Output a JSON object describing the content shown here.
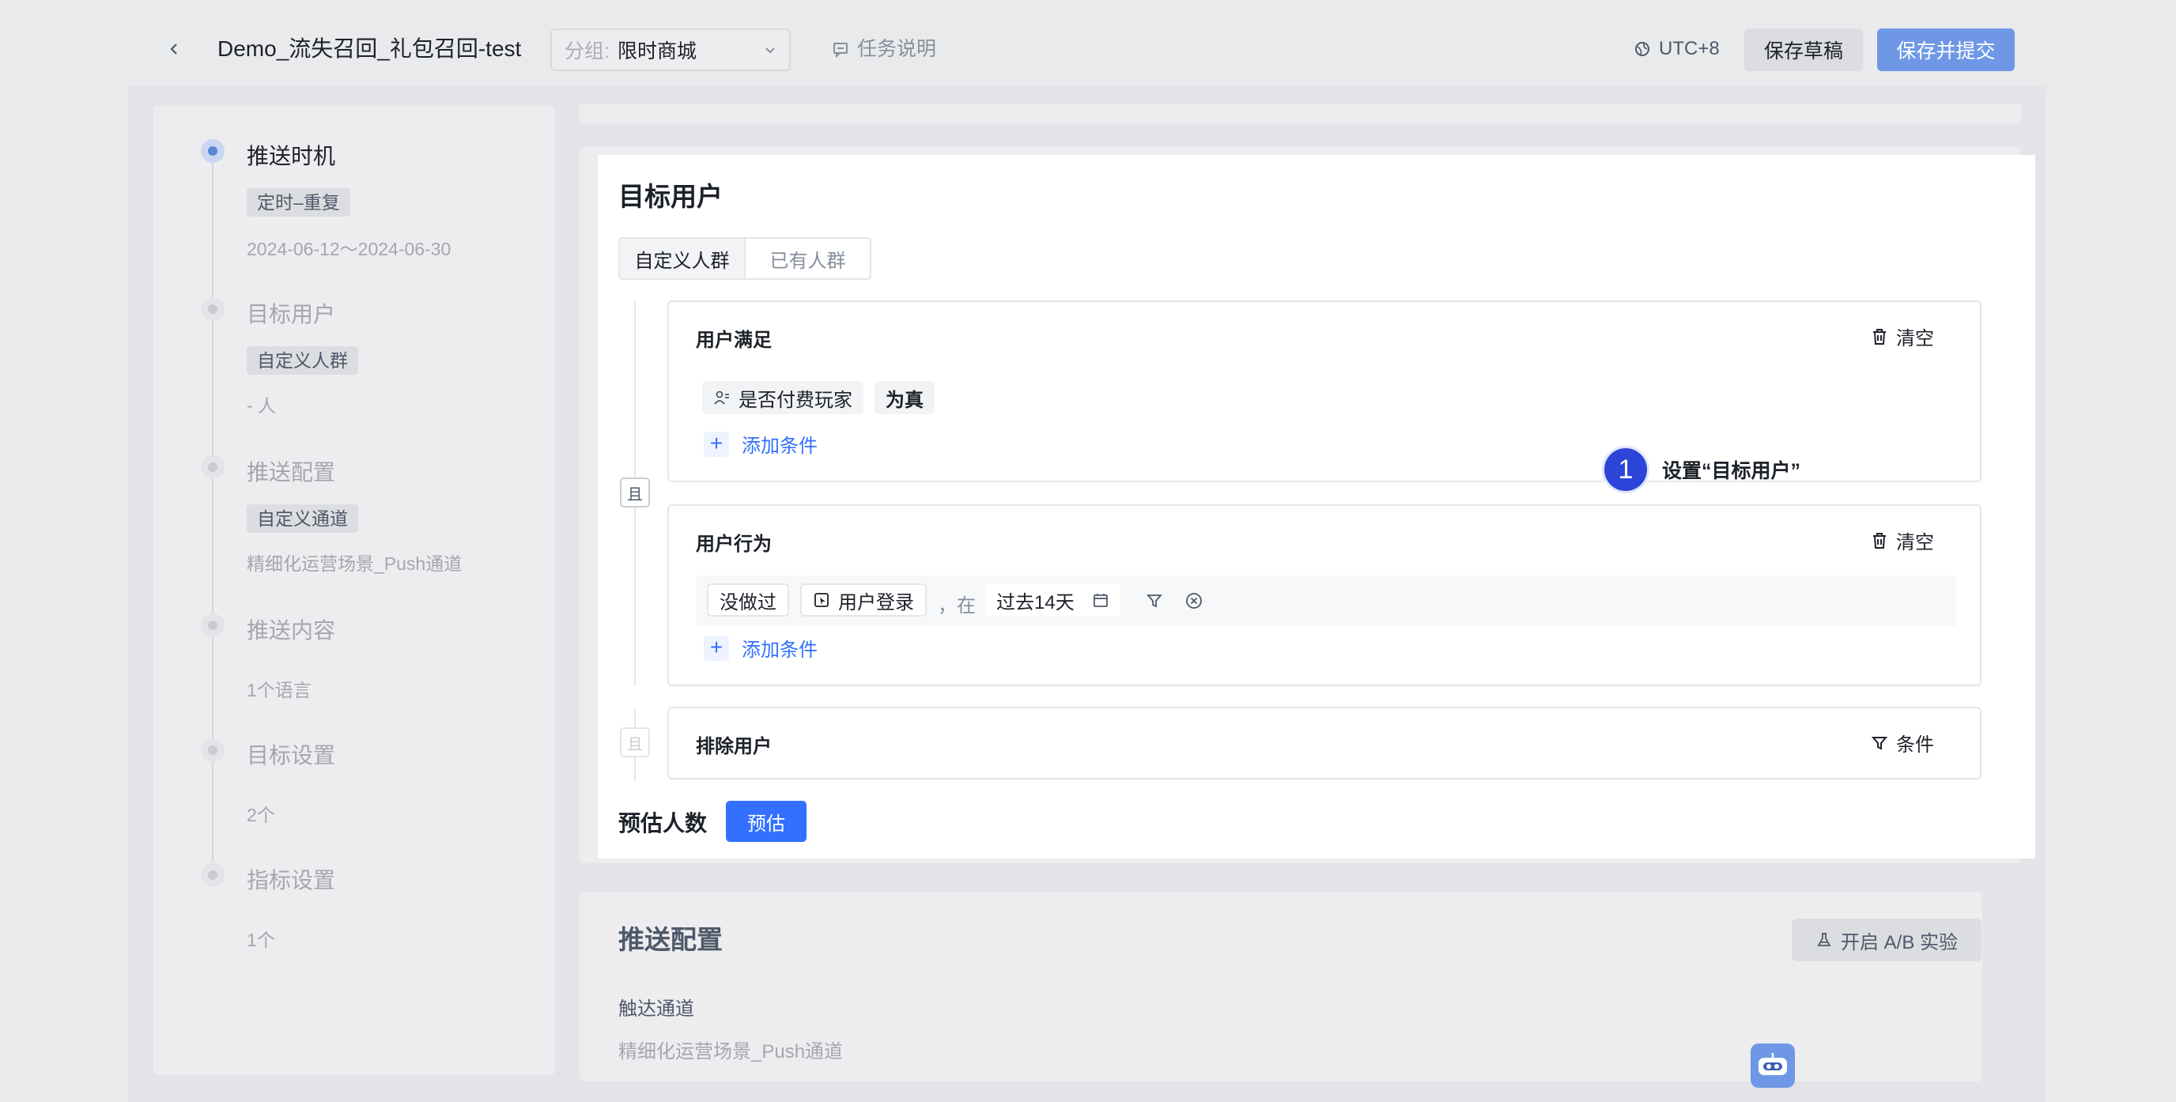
{
  "header": {
    "back_icon": "chevron-left-icon",
    "title": "Demo_流失召回_礼包召回-test",
    "group_prefix": "分组:",
    "group_value": "限时商城",
    "task_desc": "任务说明",
    "timezone": "UTC+8",
    "save_draft": "保存草稿",
    "save_submit": "保存并提交"
  },
  "steps": [
    {
      "title": "推送时机",
      "tag": "定时–重复",
      "sub": "2024-06-12～2024-06-30",
      "active": true
    },
    {
      "title": "目标用户",
      "tag": "自定义人群",
      "sub": "- 人"
    },
    {
      "title": "推送配置",
      "tag": "自定义通道",
      "sub": "精细化运营场景_Push通道"
    },
    {
      "title": "推送内容",
      "sub": "1个语言"
    },
    {
      "title": "目标设置",
      "sub": "2个"
    },
    {
      "title": "指标设置",
      "sub": "1个"
    }
  ],
  "target": {
    "title": "目标用户",
    "tabs": [
      "自定义人群",
      "已有人群"
    ],
    "and_label": "且",
    "user_match": {
      "title": "用户满足",
      "clear": "清空",
      "attr": "是否付费玩家",
      "value": "为真",
      "add": "添加条件"
    },
    "user_behavior": {
      "title": "用户行为",
      "clear": "清空",
      "did": "没做过",
      "event": "用户登录",
      "in": "，在",
      "range": "过去14天",
      "add": "添加条件"
    },
    "exclude": {
      "title": "排除用户",
      "cond": "条件"
    },
    "estimate_label": "预估人数",
    "estimate_btn": "预估"
  },
  "annotation": {
    "num": "1",
    "text": "设置“目标用户”"
  },
  "push": {
    "title": "推送配置",
    "ab": "开启 A/B 实验",
    "channel_label": "触达通道",
    "channel_value": "精细化运营场景_Push通道"
  },
  "colors": {
    "accent": "#3370ff",
    "annotation": "#2c45d8"
  }
}
